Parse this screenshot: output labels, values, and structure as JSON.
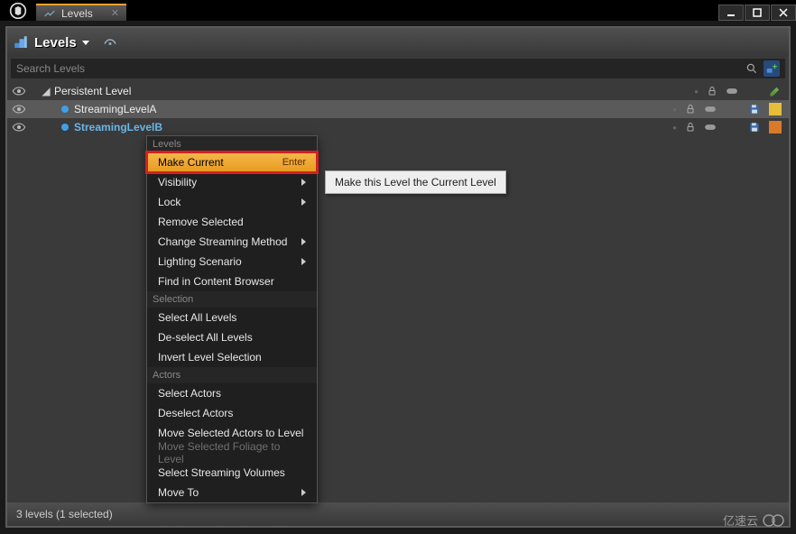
{
  "tab": {
    "title": "Levels"
  },
  "toolbar": {
    "title": "Levels"
  },
  "search": {
    "placeholder": "Search Levels"
  },
  "tree": {
    "rows": [
      {
        "name": "Persistent Level",
        "bold": false
      },
      {
        "name": "StreamingLevelA",
        "bold": false
      },
      {
        "name": "StreamingLevelB",
        "bold": true
      }
    ]
  },
  "ctx": {
    "sections": {
      "levels": "Levels",
      "selection": "Selection",
      "actors": "Actors"
    },
    "items": {
      "make_current": {
        "label": "Make Current",
        "shortcut": "Enter"
      },
      "visibility": "Visibility",
      "lock": "Lock",
      "remove_selected": "Remove Selected",
      "change_streaming": "Change Streaming Method",
      "lighting_scenario": "Lighting Scenario",
      "find_in_cb": "Find in Content Browser",
      "select_all": "Select All Levels",
      "deselect_all": "De-select All Levels",
      "invert": "Invert Level Selection",
      "select_actors": "Select Actors",
      "deselect_actors": "Deselect Actors",
      "move_sel_actors": "Move Selected Actors to Level",
      "move_sel_foliage": "Move Selected Foliage to Level",
      "select_streaming_volumes": "Select Streaming Volumes",
      "move_to": "Move To"
    }
  },
  "tooltip": "Make this Level the Current Level",
  "status": "3 levels (1 selected)",
  "brand": "亿速云"
}
